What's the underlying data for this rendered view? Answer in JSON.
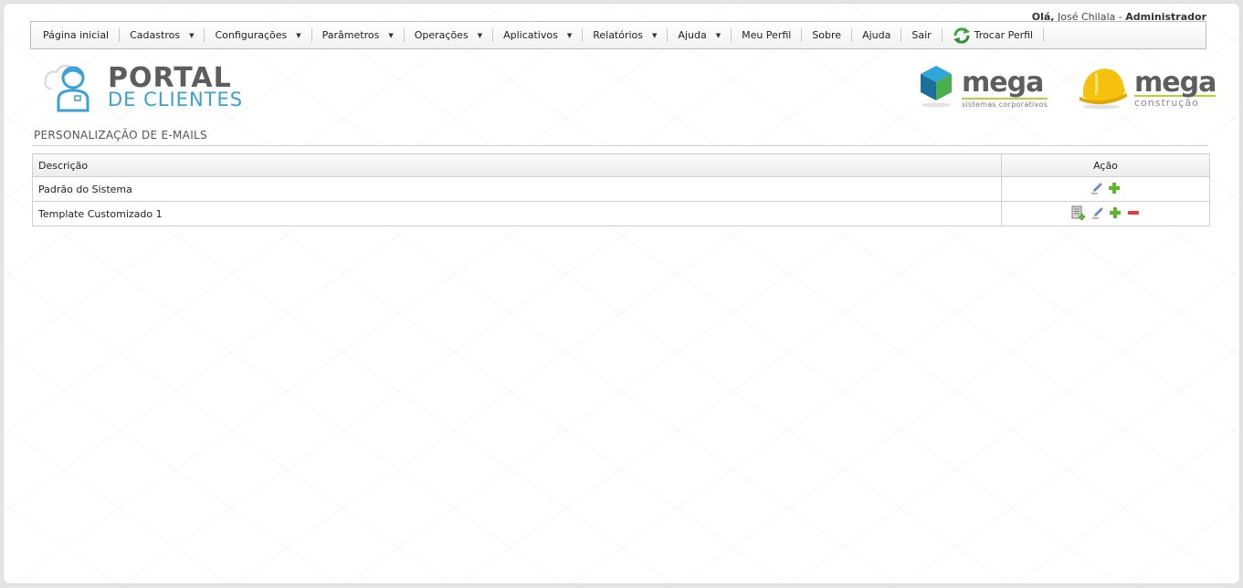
{
  "header": {
    "greeting_prefix": "Olá,",
    "user_name": "José Chilala",
    "separator": "-",
    "role": "Administrador"
  },
  "menu": {
    "items": [
      {
        "label": "Página inicial",
        "dropdown": false
      },
      {
        "label": "Cadastros",
        "dropdown": true
      },
      {
        "label": "Configurações",
        "dropdown": true
      },
      {
        "label": "Parâmetros",
        "dropdown": true
      },
      {
        "label": "Operações",
        "dropdown": true
      },
      {
        "label": "Aplicativos",
        "dropdown": true
      },
      {
        "label": "Relatórios",
        "dropdown": true
      },
      {
        "label": "Ajuda",
        "dropdown": true
      },
      {
        "label": "Meu Perfil",
        "dropdown": false
      },
      {
        "label": "Sobre",
        "dropdown": false
      },
      {
        "label": "Ajuda",
        "dropdown": false
      },
      {
        "label": "Sair",
        "dropdown": false
      }
    ],
    "switch_profile": "Trocar Perfil",
    "caret_glyph": "▼"
  },
  "logos": {
    "portal_line1": "PORTAL",
    "portal_line2": "DE CLIENTES",
    "mega1_word": "mega",
    "mega1_sub": "sistemas corporativos",
    "mega2_word": "mega",
    "mega2_sub": "construção"
  },
  "page": {
    "title": "PERSONALIZAÇÃO DE E-MAILS"
  },
  "table": {
    "col_description": "Descrição",
    "col_action": "Ação",
    "rows": [
      {
        "description": "Padrão do Sistema"
      },
      {
        "description": "Template Customizado 1"
      }
    ]
  },
  "colors": {
    "accent_blue": "#3aa0d6",
    "brand_green": "#b6cf3a",
    "add_green": "#5cb82a",
    "remove_red": "#e23b3b"
  }
}
